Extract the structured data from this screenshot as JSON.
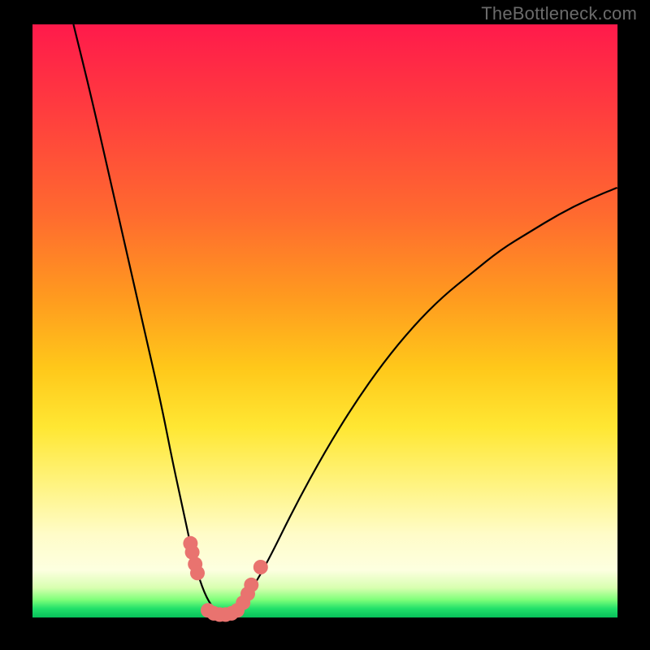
{
  "watermark": "TheBottleneck.com",
  "chart_data": {
    "type": "line",
    "title": "",
    "xlabel": "",
    "ylabel": "",
    "xlim": [
      0,
      100
    ],
    "ylim": [
      0,
      100
    ],
    "grid": false,
    "legend": false,
    "series": [
      {
        "name": "bottleneck-curve",
        "x": [
          7,
          10,
          13,
          16,
          19,
          22,
          24,
          26,
          27.5,
          29,
          30.5,
          32,
          33.5,
          35,
          37,
          40,
          45,
          50,
          55,
          60,
          65,
          70,
          75,
          80,
          85,
          90,
          95,
          100
        ],
        "y": [
          100,
          88,
          75,
          62,
          49,
          36,
          26,
          17,
          10,
          5,
          2,
          0.5,
          0.5,
          1.5,
          4,
          9,
          19,
          28,
          36,
          43,
          49,
          54,
          58,
          62,
          65,
          68,
          70.5,
          72.5
        ]
      },
      {
        "name": "highlight-points",
        "type": "scatter",
        "points": [
          {
            "x": 27.0,
            "y": 12.5
          },
          {
            "x": 27.3,
            "y": 11.0
          },
          {
            "x": 27.8,
            "y": 9.0
          },
          {
            "x": 28.2,
            "y": 7.5
          },
          {
            "x": 30.0,
            "y": 1.2
          },
          {
            "x": 31.0,
            "y": 0.7
          },
          {
            "x": 32.0,
            "y": 0.5
          },
          {
            "x": 33.0,
            "y": 0.5
          },
          {
            "x": 34.0,
            "y": 0.7
          },
          {
            "x": 35.0,
            "y": 1.2
          },
          {
            "x": 36.0,
            "y": 2.5
          },
          {
            "x": 36.8,
            "y": 4.0
          },
          {
            "x": 37.4,
            "y": 5.5
          },
          {
            "x": 39.0,
            "y": 8.5
          }
        ]
      }
    ],
    "background_gradient": {
      "top": "#ff1a4b",
      "mid": "#ffe733",
      "bottom": "#07c05a"
    }
  }
}
